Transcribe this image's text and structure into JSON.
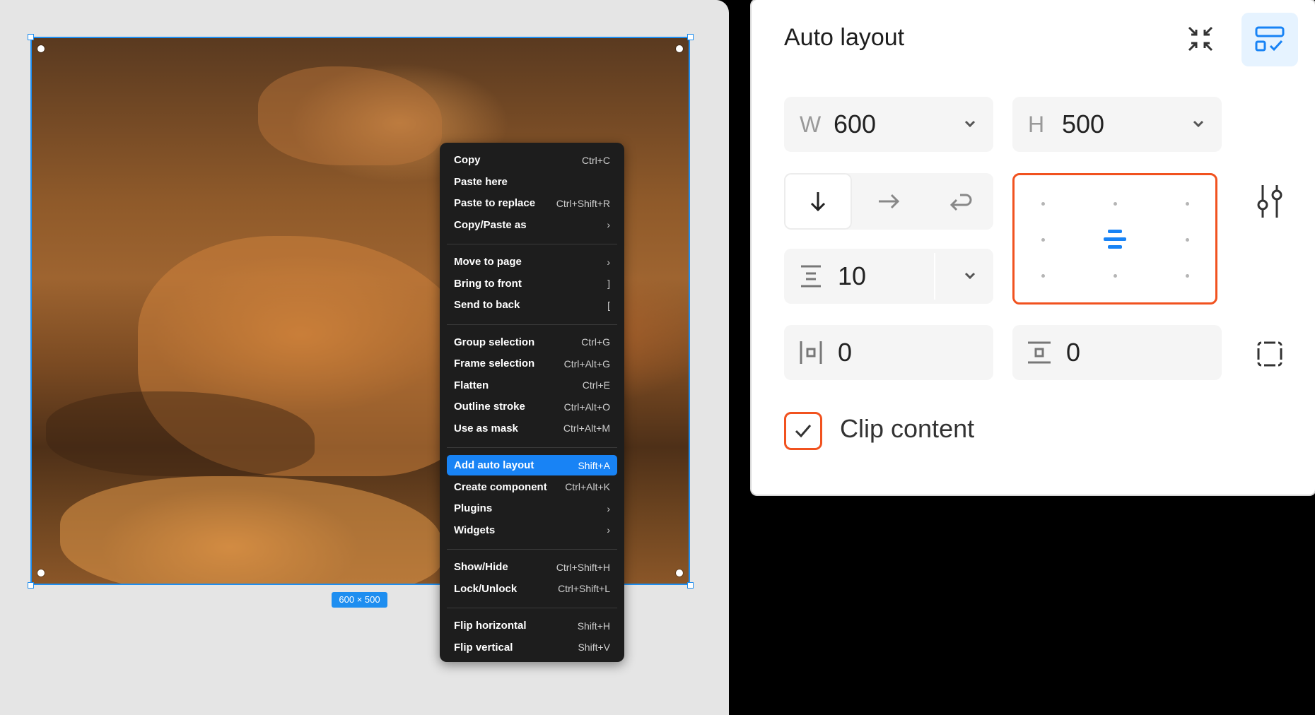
{
  "canvas": {
    "size_badge": "600 × 500"
  },
  "context_menu": {
    "groups": [
      [
        {
          "label": "Copy",
          "shortcut": "Ctrl+C"
        },
        {
          "label": "Paste here",
          "shortcut": ""
        },
        {
          "label": "Paste to replace",
          "shortcut": "Ctrl+Shift+R"
        },
        {
          "label": "Copy/Paste as",
          "shortcut": "›"
        }
      ],
      [
        {
          "label": "Move to page",
          "shortcut": "›"
        },
        {
          "label": "Bring to front",
          "shortcut": "]"
        },
        {
          "label": "Send to back",
          "shortcut": "["
        }
      ],
      [
        {
          "label": "Group selection",
          "shortcut": "Ctrl+G"
        },
        {
          "label": "Frame selection",
          "shortcut": "Ctrl+Alt+G"
        },
        {
          "label": "Flatten",
          "shortcut": "Ctrl+E"
        },
        {
          "label": "Outline stroke",
          "shortcut": "Ctrl+Alt+O"
        },
        {
          "label": "Use as mask",
          "shortcut": "Ctrl+Alt+M"
        }
      ],
      [
        {
          "label": "Add auto layout",
          "shortcut": "Shift+A",
          "selected": true
        },
        {
          "label": "Create component",
          "shortcut": "Ctrl+Alt+K"
        },
        {
          "label": "Plugins",
          "shortcut": "›"
        },
        {
          "label": "Widgets",
          "shortcut": "›"
        }
      ],
      [
        {
          "label": "Show/Hide",
          "shortcut": "Ctrl+Shift+H"
        },
        {
          "label": "Lock/Unlock",
          "shortcut": "Ctrl+Shift+L"
        }
      ],
      [
        {
          "label": "Flip horizontal",
          "shortcut": "Shift+H"
        },
        {
          "label": "Flip vertical",
          "shortcut": "Shift+V"
        }
      ]
    ]
  },
  "panel": {
    "title": "Auto layout",
    "width": {
      "label": "W",
      "value": "600"
    },
    "height": {
      "label": "H",
      "value": "500"
    },
    "gap": {
      "value": "10"
    },
    "padding_horizontal": {
      "value": "0"
    },
    "padding_vertical": {
      "value": "0"
    },
    "direction_selected": "vertical",
    "alignment": "center",
    "clip_content": {
      "label": "Clip content",
      "checked": true
    },
    "colors": {
      "accent": "#1883f5",
      "highlight": "#f1521f"
    }
  }
}
